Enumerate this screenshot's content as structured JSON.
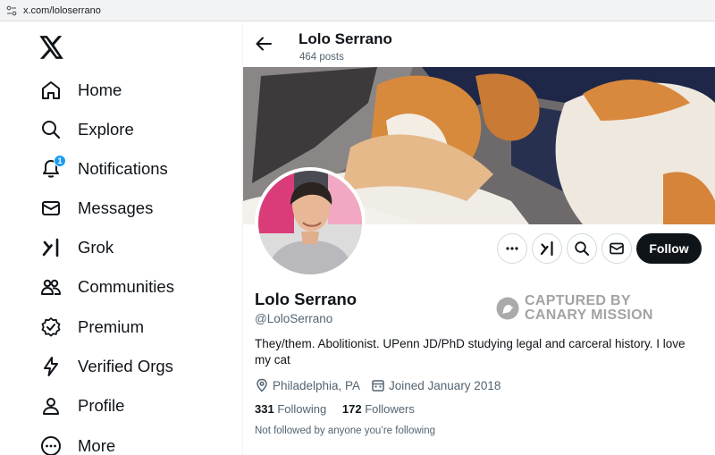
{
  "browser": {
    "url": "x.com/loloserrano"
  },
  "nav": {
    "items": [
      {
        "label": "Home",
        "icon": "home-icon"
      },
      {
        "label": "Explore",
        "icon": "search-icon"
      },
      {
        "label": "Notifications",
        "icon": "bell-icon",
        "badge": "1"
      },
      {
        "label": "Messages",
        "icon": "envelope-icon"
      },
      {
        "label": "Grok",
        "icon": "grok-icon"
      },
      {
        "label": "Communities",
        "icon": "people-icon"
      },
      {
        "label": "Premium",
        "icon": "verified-badge-icon"
      },
      {
        "label": "Verified Orgs",
        "icon": "lightning-icon"
      },
      {
        "label": "Profile",
        "icon": "person-icon"
      },
      {
        "label": "More",
        "icon": "more-circle-icon"
      }
    ]
  },
  "header": {
    "name": "Lolo Serrano",
    "posts": "464 posts"
  },
  "profile": {
    "name": "Lolo Serrano",
    "handle": "@LoloSerrano",
    "bio": "They/them. Abolitionist. UPenn JD/PhD studying legal and carceral history. I love my cat",
    "location": "Philadelphia, PA",
    "joined": "Joined January 2018",
    "following_count": "331",
    "following_label": "Following",
    "followers_count": "172",
    "followers_label": "Followers",
    "not_followed": "Not followed by anyone you’re following",
    "follow_label": "Follow"
  },
  "watermark": {
    "line1": "CAPTURED BY",
    "line2": "CANARY MISSION"
  },
  "colors": {
    "accent": "#1d9bf0",
    "text": "#0f1419",
    "secondary": "#536471",
    "follow_bg": "#0f1419"
  }
}
